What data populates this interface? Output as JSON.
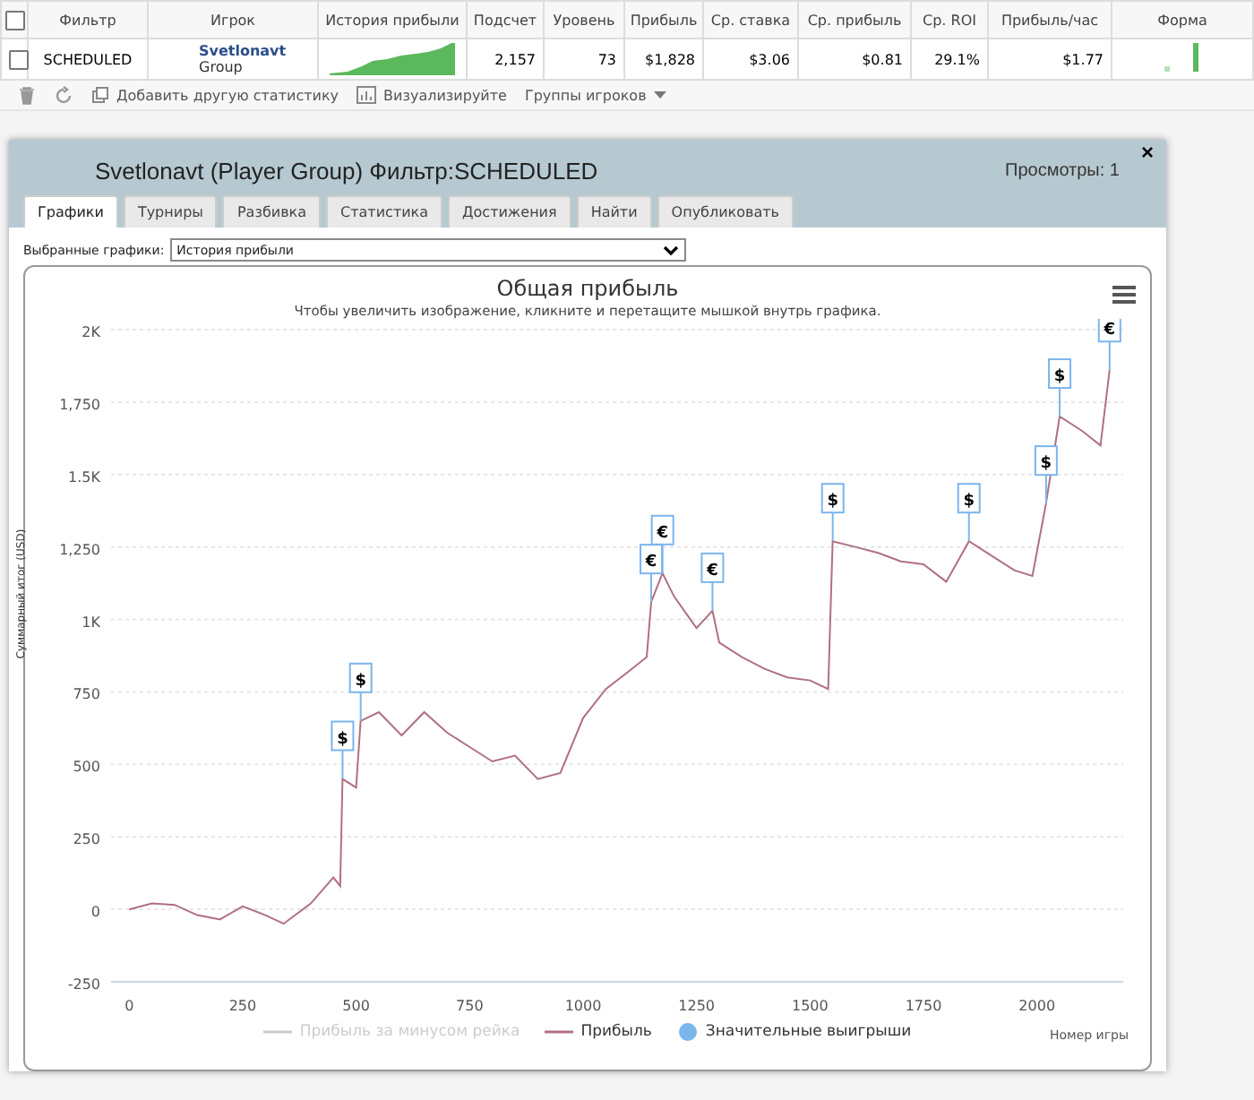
{
  "stats_table": {
    "select_all_checked": false,
    "columns": [
      "Фильтр",
      "Игрок",
      "История прибыли",
      "Подсчет",
      "Уровень",
      "Прибыль",
      "Ср. ставка",
      "Ср. прибыль",
      "Ср. ROI",
      "Прибыль/час",
      "Форма"
    ],
    "rows": [
      {
        "checked": false,
        "filter": "SCHEDULED",
        "player": "Svetlonavt",
        "player_sub": "Group",
        "count": "2,157",
        "level": "73",
        "profit": "$1,828",
        "avg_stake": "$3.06",
        "avg_profit": "$0.81",
        "roi": "29.1%",
        "profit_hour": "$1.77"
      }
    ]
  },
  "toolbar": {
    "add_stat": "Добавить другую статистику",
    "visualize": "Визуализируйте",
    "groups": "Группы игроков"
  },
  "panel": {
    "title": "Svetlonavt (Player Group) Фильтр:SCHEDULED",
    "views": "Просмотры: 1",
    "close": "×",
    "tabs": [
      {
        "label": "Графики",
        "selected": true
      },
      {
        "label": "Турниры",
        "selected": false
      },
      {
        "label": "Разбивка",
        "selected": false
      },
      {
        "label": "Статистика",
        "selected": false
      },
      {
        "label": "Достижения",
        "selected": false
      },
      {
        "label": "Найти",
        "selected": false
      },
      {
        "label": "Опубликовать",
        "selected": false
      }
    ],
    "chart_select": {
      "label": "Выбранные графики:",
      "value": "История прибыли"
    },
    "chart": {
      "subtitle": "Чтобы увеличить изображение, кликните и перетащите мышкой внутрь графика.",
      "legend": [
        {
          "label": "Прибыль за минусом рейка",
          "kind": "line",
          "enabled": false
        },
        {
          "kind": "series",
          "enabled": true
        },
        {
          "label": "Значительные выигрыши",
          "kind": "dot",
          "enabled": true
        }
      ],
      "chart_data": {
        "type": "line",
        "title": "Общая прибыль",
        "xlabel": "Номер игры",
        "ylabel": "Суммарный итог (USD)",
        "x": [
          0,
          50,
          100,
          150,
          200,
          250,
          300,
          340,
          400,
          450,
          465,
          470,
          500,
          510,
          550,
          600,
          650,
          700,
          750,
          800,
          850,
          900,
          950,
          1000,
          1050,
          1100,
          1140,
          1150,
          1175,
          1200,
          1250,
          1285,
          1300,
          1350,
          1400,
          1450,
          1500,
          1540,
          1550,
          1600,
          1650,
          1700,
          1750,
          1800,
          1850,
          1900,
          1950,
          1990,
          2020,
          2050,
          2100,
          2140,
          2160
        ],
        "series": [
          {
            "name": "Прибыль",
            "color": "#b07080",
            "values": [
              0,
              20,
              15,
              -20,
              -35,
              10,
              -20,
              -50,
              20,
              110,
              80,
              450,
              420,
              650,
              680,
              600,
              680,
              610,
              560,
              510,
              530,
              450,
              470,
              660,
              760,
              820,
              870,
              1060,
              1160,
              1080,
              970,
              1030,
              920,
              870,
              830,
              800,
              790,
              760,
              1270,
              1250,
              1230,
              1200,
              1190,
              1130,
              1270,
              1220,
              1170,
              1150,
              1400,
              1700,
              1650,
              1600,
              1860
            ]
          }
        ],
        "grid": true,
        "xlim": [
          -40,
          2190
        ],
        "ylim": [
          -250,
          2000
        ],
        "xticks": [
          0,
          250,
          500,
          750,
          1000,
          1250,
          1500,
          1750,
          2000
        ],
        "yticks": [
          -250,
          0,
          250,
          500,
          {
            "value": 750,
            "label": "750"
          },
          {
            "value": 1000,
            "label": "1K"
          },
          {
            "value": 1250,
            "label": "1,250"
          },
          {
            "value": 1500,
            "label": "1.5K"
          },
          {
            "value": 1750,
            "label": "1,750"
          },
          {
            "value": 2000,
            "label": "2K"
          }
        ],
        "annotations": [
          {
            "x": 470,
            "y": 450,
            "text": "$"
          },
          {
            "x": 510,
            "y": 650,
            "text": "$"
          },
          {
            "x": 1150,
            "y": 1060,
            "text": "€"
          },
          {
            "x": 1175,
            "y": 1160,
            "text": "€"
          },
          {
            "x": 1285,
            "y": 1030,
            "text": "€"
          },
          {
            "x": 1550,
            "y": 1270,
            "text": "$"
          },
          {
            "x": 1850,
            "y": 1270,
            "text": "$"
          },
          {
            "x": 2020,
            "y": 1400,
            "text": "$"
          },
          {
            "x": 2050,
            "y": 1700,
            "text": "$"
          },
          {
            "x": 2160,
            "y": 1860,
            "text": "€"
          }
        ]
      }
    }
  }
}
